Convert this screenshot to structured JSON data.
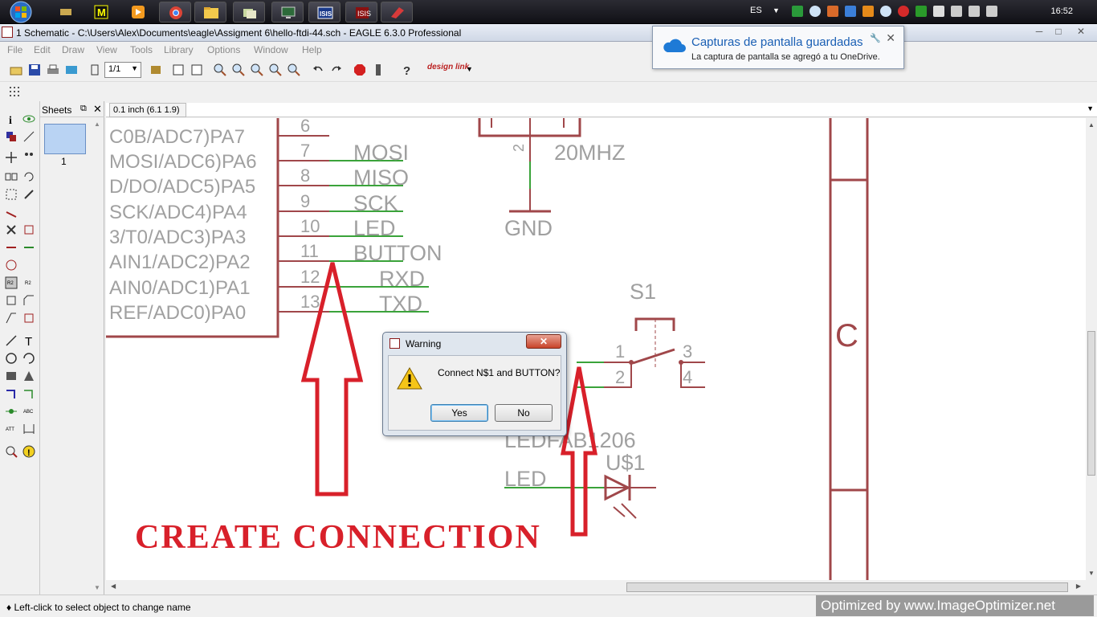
{
  "taskbar": {
    "language": "ES",
    "clock": "16:52"
  },
  "window": {
    "title": "1 Schematic - C:\\Users\\Alex\\Documents\\eagle\\Assigment 6\\hello-ftdi-44.sch - EAGLE 6.3.0 Professional",
    "minimize": "─",
    "maximize": "□",
    "close": "✕"
  },
  "menu": {
    "items": [
      "File",
      "Edit",
      "Draw",
      "View",
      "Tools",
      "Library",
      "Options",
      "Window",
      "Help"
    ]
  },
  "toolbar": {
    "zoom_value": "1/1",
    "designlink_label": "design link"
  },
  "sheets": {
    "title": "Sheets",
    "sheet_number": "1"
  },
  "coordinates": {
    "readout": "0.1 inch (6.1 1.9)"
  },
  "schematic": {
    "pin_labels": [
      "C0B/ADC7)PA7",
      "MOSI/ADC6)PA6",
      "D/DO/ADC5)PA5",
      "SCK/ADC4)PA4",
      "3/T0/ADC3)PA3",
      "AIN1/ADC2)PA2",
      "AIN0/ADC1)PA1",
      "REF/ADC0)PA0"
    ],
    "pin_numbers": [
      "6",
      "7",
      "8",
      "9",
      "10",
      "11",
      "12",
      "13"
    ],
    "net_labels": [
      "MOSI",
      "MISO",
      "SCK",
      "LED",
      "BUTTON",
      "RXD",
      "TXD"
    ],
    "crystal_label": "20MHZ",
    "crystal_pin": "2",
    "gnd_label": "GND",
    "switch_name": "S1",
    "switch_pins": [
      "1",
      "2",
      "3",
      "4"
    ],
    "led_package": "LEDFAB1206",
    "led_name": "U$1",
    "led_net": "LED",
    "frame_label": "C",
    "annotation": "CREATE  CONNECTION"
  },
  "dialog": {
    "title": "Warning",
    "message": "Connect N$1 and BUTTON?",
    "yes_label": "Yes",
    "no_label": "No",
    "close_label": "✕"
  },
  "notification": {
    "title": "Capturas de pantalla guardadas",
    "body": "La captura de pantalla se agregó a tu OneDrive."
  },
  "status": {
    "text": "♦ Left-click to select object to change name",
    "watermark": "Optimized by www.ImageOptimizer.net"
  },
  "colors": {
    "accent_red": "#d8202a",
    "wire_green": "#3aa33a",
    "symbol_maroon": "#a0474a",
    "text_gray": "#a0a0a0"
  }
}
